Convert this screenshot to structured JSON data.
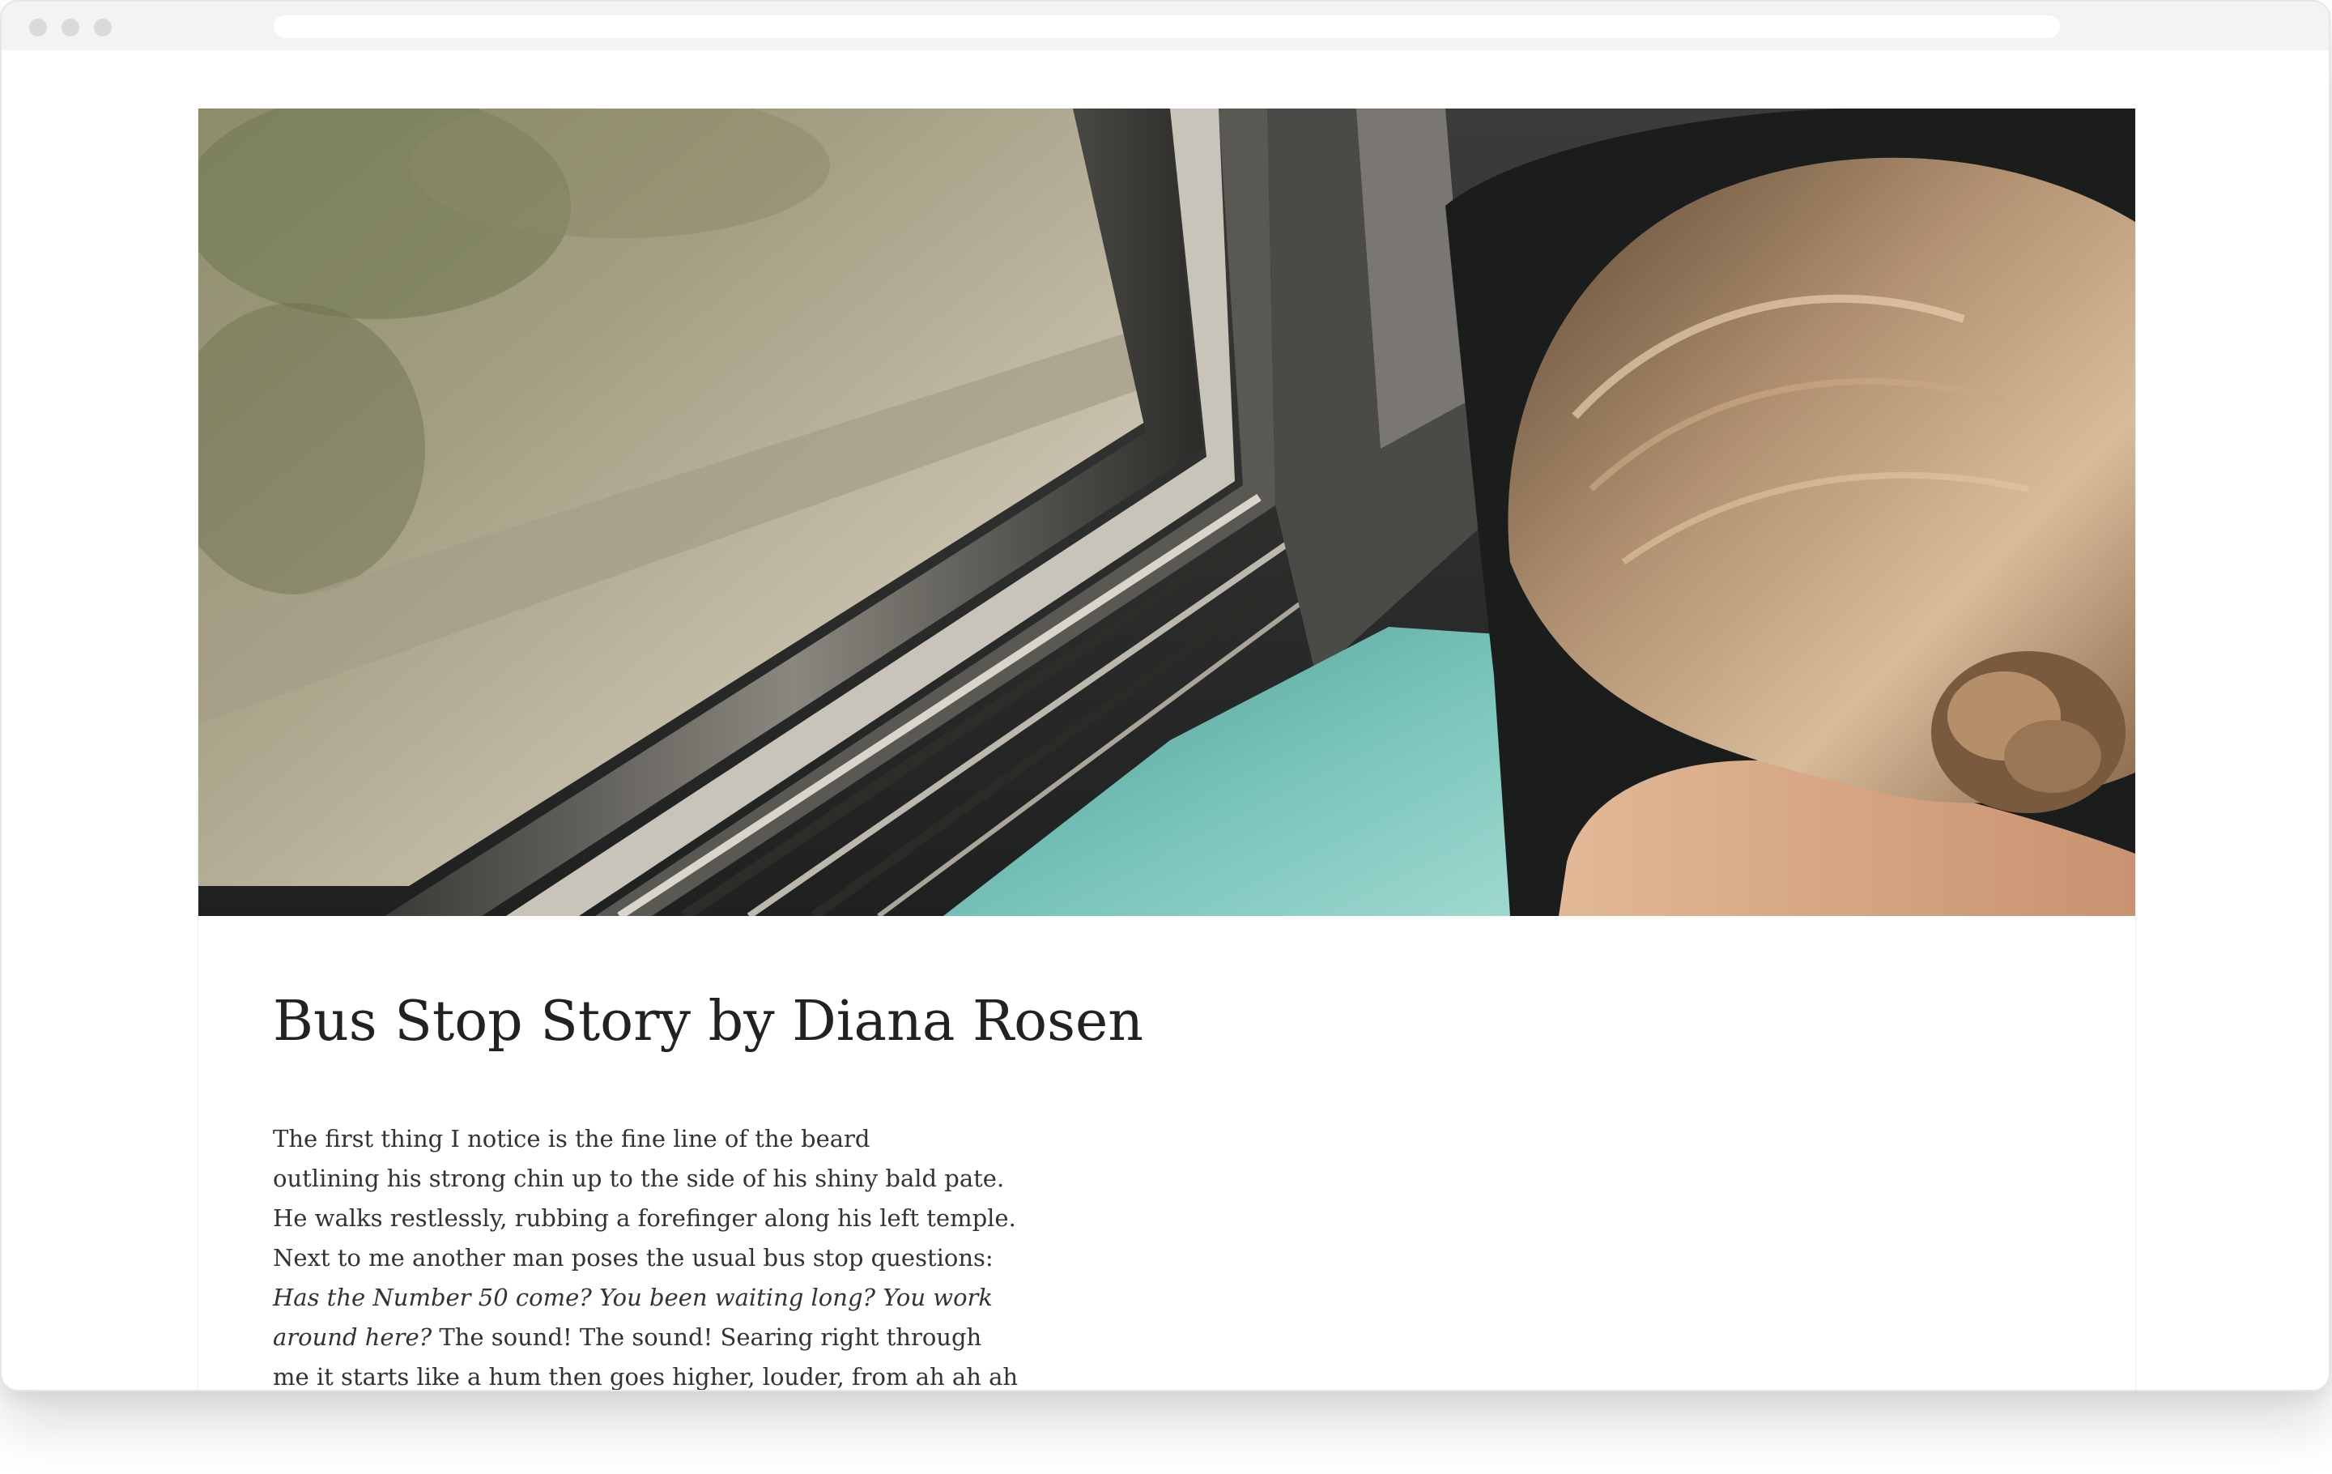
{
  "article": {
    "title": "Bus Stop Story by Diana Rosen",
    "hero_image": {
      "subject": "woman-sleeping-by-train-window"
    },
    "poem": [
      {
        "text": "The first thing I notice is the fine line of the beard"
      },
      {
        "text": "outlining his strong chin up to the side of his shiny bald pate."
      },
      {
        "text": "He walks restlessly, rubbing a forefinger along his left temple."
      },
      {
        "text": "Next to me another man poses the usual bus stop questions:"
      },
      {
        "italic": "Has the Number 50 come? You been waiting long? You work"
      },
      {
        "italic": "around here?",
        "text": " The sound! The sound! Searing right through"
      },
      {
        "text": "me it starts like a hum then goes higher, louder, from ah ah ah"
      }
    ]
  },
  "colors": {
    "title": "#222222",
    "body_text": "#333333",
    "chrome_bar": "#f3f3f5",
    "traffic_light": "#dadadd"
  }
}
